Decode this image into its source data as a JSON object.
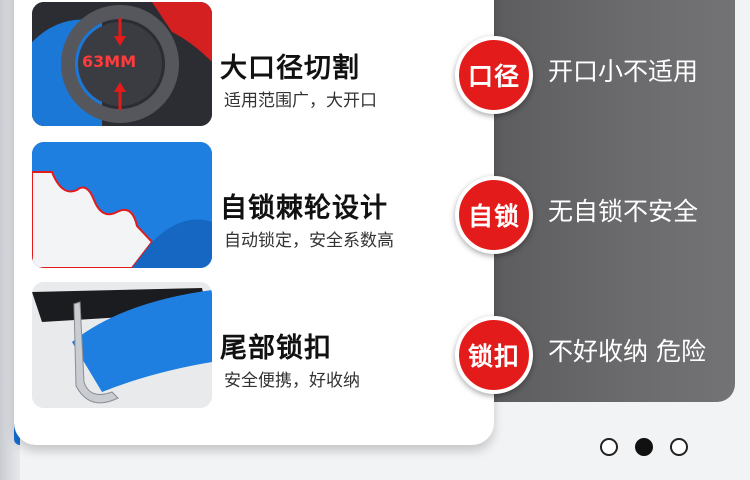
{
  "features": [
    {
      "image_label": "63MM",
      "title": "大口径切割",
      "subtitle": "适用范围广，大开口",
      "badge": "口径",
      "contrast": "开口小不适用"
    },
    {
      "title": "自锁棘轮设计",
      "subtitle": "自动锁定，安全系数高",
      "badge": "自锁",
      "contrast": "无自锁不安全"
    },
    {
      "title": "尾部锁扣",
      "subtitle": "安全便携，好收纳",
      "badge": "锁扣",
      "contrast": "不好收纳 危险"
    }
  ],
  "carousel": {
    "count": 3,
    "active_index": 1
  },
  "colors": {
    "badge_red": "#e41b1b",
    "tool_blue": "#1e7fe0",
    "panel_gray": "#6b6b6d"
  }
}
